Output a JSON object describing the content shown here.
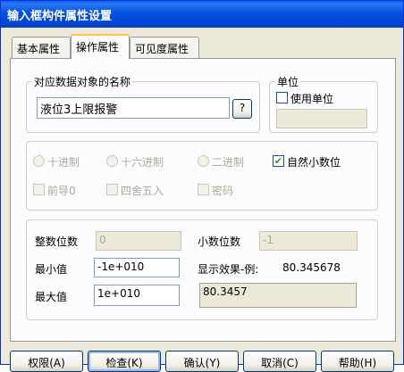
{
  "window": {
    "title": "输入框构件属性设置"
  },
  "tabs": [
    {
      "label": "基本属性"
    },
    {
      "label": "操作属性"
    },
    {
      "label": "可见度属性"
    }
  ],
  "name_group": {
    "legend": "对应数据对象的名称",
    "value": "液位3上限报警",
    "browse_label": "?"
  },
  "unit_group": {
    "legend": "单位",
    "use_unit_label": "使用单位",
    "use_unit_checked": false,
    "unit_value": ""
  },
  "format_group": {
    "radios": [
      {
        "label": "十进制"
      },
      {
        "label": "十六进制"
      },
      {
        "label": "二进制"
      }
    ],
    "natural_decimal": {
      "label": "自然小数位",
      "checked": true
    },
    "leading_zero": {
      "label": "前导0"
    },
    "round": {
      "label": "四舍五入"
    },
    "password": {
      "label": "密码"
    }
  },
  "number_group": {
    "int_digits_label": "整数位数",
    "int_digits_value": "0",
    "dec_digits_label": "小数位数",
    "dec_digits_value": "-1",
    "min_label": "最小值",
    "min_value": "-1e+010",
    "max_label": "最大值",
    "max_value": "1e+010",
    "preview_label": "显示效果-例:",
    "preview_example": "80.345678",
    "preview_result": "80.3457"
  },
  "buttons": {
    "permission": "权限(A)",
    "check": "检查(K)",
    "confirm": "确认(Y)",
    "cancel": "取消(C)",
    "help": "帮助(H)"
  }
}
